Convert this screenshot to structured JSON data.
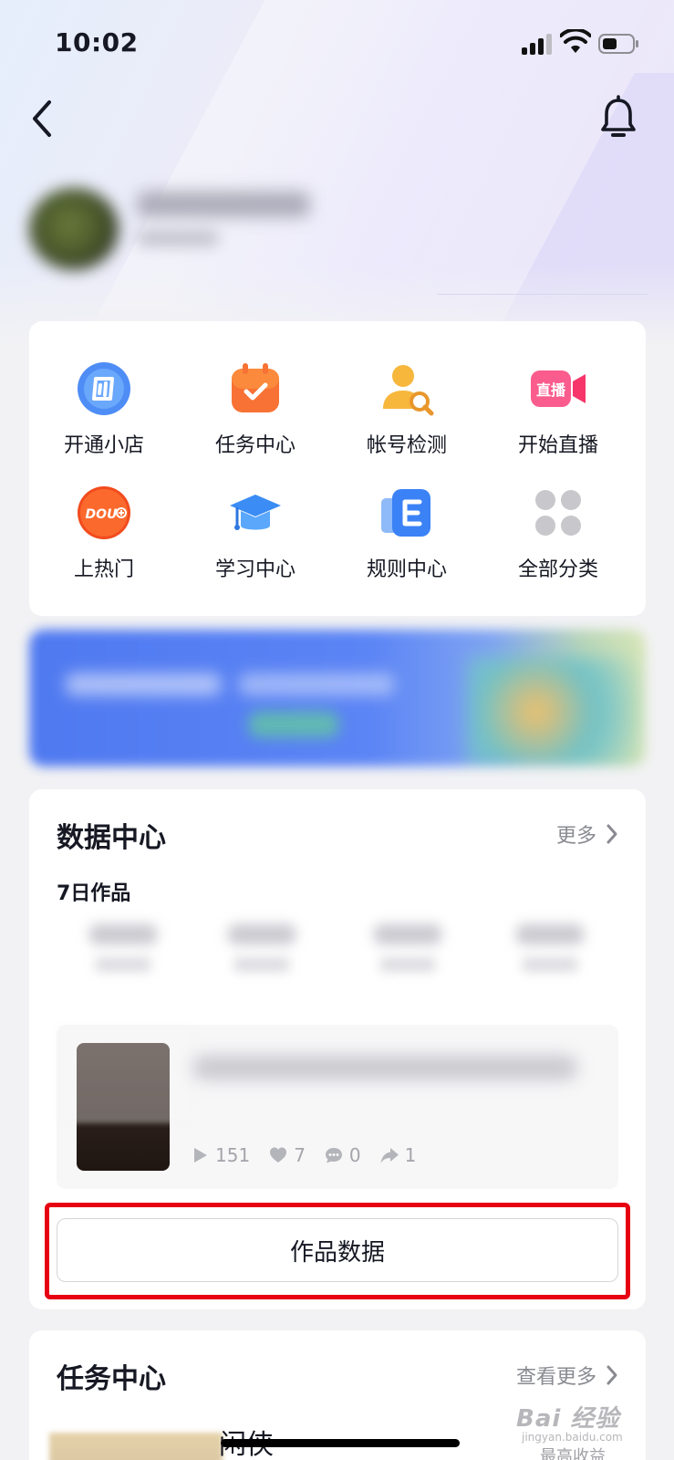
{
  "status_bar": {
    "time": "10:02"
  },
  "tools": [
    {
      "label": "开通小店",
      "icon": "store-icon"
    },
    {
      "label": "任务中心",
      "icon": "task-calendar-icon"
    },
    {
      "label": "帐号检测",
      "icon": "account-check-icon"
    },
    {
      "label": "开始直播",
      "icon": "live-camera-icon"
    },
    {
      "label": "上热门",
      "icon": "dou-plus-icon"
    },
    {
      "label": "学习中心",
      "icon": "graduation-cap-icon"
    },
    {
      "label": "规则中心",
      "icon": "rules-doc-icon"
    },
    {
      "label": "全部分类",
      "icon": "all-categories-icon"
    }
  ],
  "live_badge_text": "直播",
  "dou_badge_text": "DOU",
  "data_center": {
    "title": "数据中心",
    "more_label": "更多",
    "subtitle": "7日作品",
    "video": {
      "plays": "151",
      "likes": "7",
      "comments": "0",
      "shares": "1"
    },
    "works_button": "作品数据"
  },
  "task_center": {
    "title": "任务中心",
    "more_label": "查看更多",
    "first_item_title": "闲侠",
    "first_item_meta": "最高收益"
  },
  "watermark": {
    "main": "Bai 经验",
    "sub": "jingyan.baidu.com"
  },
  "colors": {
    "accent_red": "#e60012",
    "primary_text": "#161823",
    "secondary_text": "#8a8b91"
  }
}
